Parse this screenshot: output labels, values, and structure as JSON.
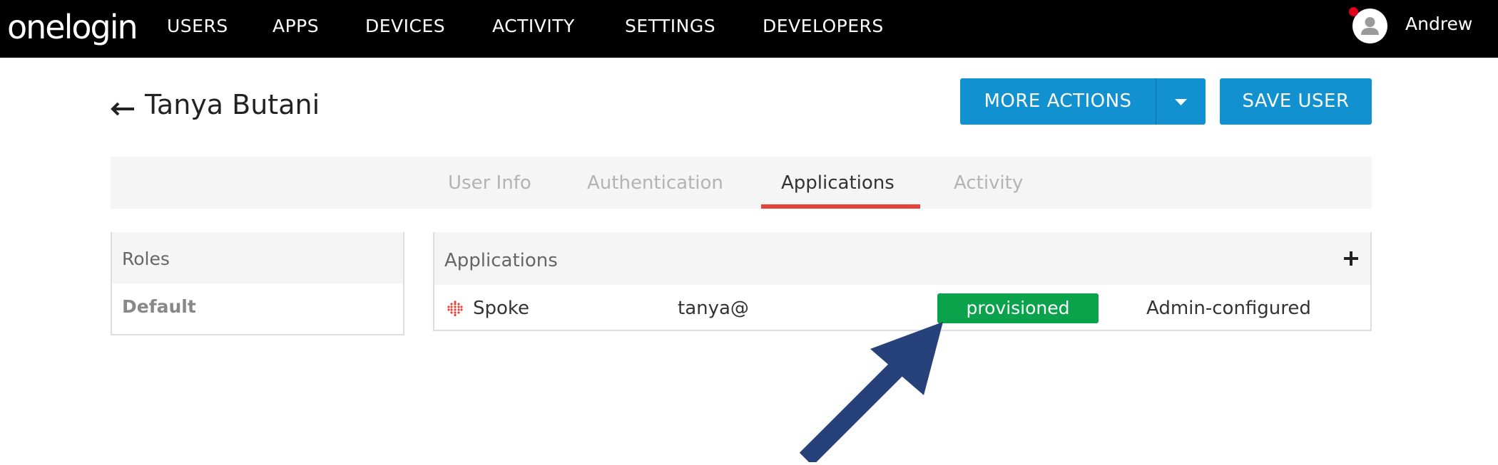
{
  "header": {
    "logo": "onelogin",
    "nav": [
      "USERS",
      "APPS",
      "DEVICES",
      "ACTIVITY",
      "SETTINGS",
      "DEVELOPERS"
    ],
    "user": "Andrew"
  },
  "page": {
    "title": "Tanya Butani",
    "more_actions_label": "MORE ACTIONS",
    "save_label": "SAVE USER"
  },
  "tabs": [
    "User Info",
    "Authentication",
    "Applications",
    "Activity"
  ],
  "active_tab": "Applications",
  "roles": {
    "header": "Roles",
    "items": [
      "Default"
    ]
  },
  "applications": {
    "header": "Applications",
    "rows": [
      {
        "name": "Spoke",
        "login": "tanya@",
        "status": "provisioned",
        "type": "Admin-configured"
      }
    ]
  },
  "colors": {
    "accent": "#1191d0",
    "tab_underline": "#e8413a",
    "status_provisioned": "#0aa34c",
    "annotation_arrow": "#27417a"
  },
  "icons": {
    "back": "arrow-left-icon",
    "caret": "chevron-down-icon",
    "add": "plus-icon",
    "avatar": "user-avatar-icon",
    "app": "spoke-app-icon"
  }
}
